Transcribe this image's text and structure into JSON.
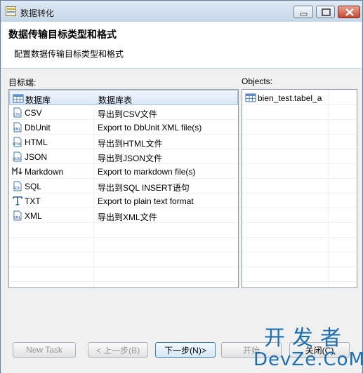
{
  "window": {
    "title": "数据转化"
  },
  "header": {
    "title": "数据传输目标类型和格式",
    "description": "配置数据传输目标类型和格式"
  },
  "target_panel": {
    "label": "目标端:",
    "rows": [
      {
        "icon": "database-table-icon",
        "name": "数据库",
        "desc": "数据库表",
        "selected": true
      },
      {
        "icon": "csv-file-icon",
        "name": "CSV",
        "desc": "导出到CSV文件"
      },
      {
        "icon": "xml-file-icon",
        "name": "DbUnit",
        "desc": "Export to DbUnit XML file(s)"
      },
      {
        "icon": "html-file-icon",
        "name": "HTML",
        "desc": "导出到HTML文件"
      },
      {
        "icon": "json-file-icon",
        "name": "JSON",
        "desc": "导出到JSON文件"
      },
      {
        "icon": "markdown-icon",
        "name": "Markdown",
        "desc": "Export to markdown file(s)"
      },
      {
        "icon": "sql-file-icon",
        "name": "SQL",
        "desc": "导出到SQL INSERT语句"
      },
      {
        "icon": "text-icon",
        "name": "TXT",
        "desc": "Export to plain text format"
      },
      {
        "icon": "xml-file-icon",
        "name": "XML",
        "desc": "导出到XML文件"
      }
    ]
  },
  "objects_panel": {
    "label": "Objects:",
    "rows": [
      {
        "icon": "table-icon",
        "name": "bien_test.tabel_a"
      }
    ]
  },
  "buttons": {
    "new_task": "New Task",
    "prev": "< 上一步(B)",
    "next": "下一步(N)>",
    "start": "开始",
    "close": "关闭(C)"
  },
  "watermark": {
    "cn": "开发者",
    "en": "DevZe.CoM"
  },
  "colors": {
    "accent": "#3c7fb1",
    "watermark": "#1d6fb0",
    "selection": "#dbe7f7"
  }
}
